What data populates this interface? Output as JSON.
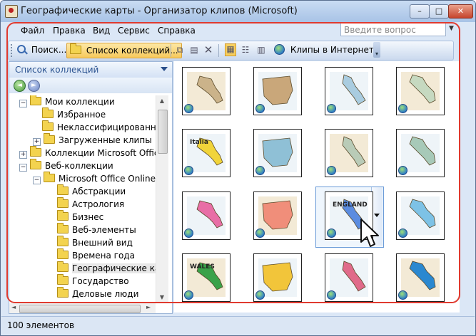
{
  "window": {
    "title": "Географические карты - Организатор клипов (Microsoft)",
    "buttons": {
      "minimize": "–",
      "maximize": "□",
      "close": "✕"
    }
  },
  "menu": {
    "items": [
      "Файл",
      "Правка",
      "Вид",
      "Сервис",
      "Справка"
    ],
    "help_placeholder": "Введите вопрос"
  },
  "toolbar": {
    "search_label": "Поиск...",
    "collections_label": "Список коллекций...",
    "online_label": "Клипы в Интернете"
  },
  "collections_pane": {
    "header": "Список коллекций",
    "tree": [
      {
        "label": "Мои коллекции",
        "expander": "−"
      },
      {
        "label": "Избранное"
      },
      {
        "label": "Неклассифицированны"
      },
      {
        "label": "Загруженные клипы",
        "expander": "+"
      },
      {
        "label": "Коллекции Microsoft Office",
        "expander": "+"
      },
      {
        "label": "Веб-коллекции",
        "expander": "−"
      },
      {
        "label": "Microsoft Office Online",
        "expander": "−"
      },
      {
        "label": "Абстракции"
      },
      {
        "label": "Астрология"
      },
      {
        "label": "Бизнес"
      },
      {
        "label": "Веб-элементы"
      },
      {
        "label": "Внешний вид"
      },
      {
        "label": "Времена года"
      },
      {
        "label": "Географические кар",
        "selected": true
      },
      {
        "label": "Государство"
      },
      {
        "label": "Деловые люди"
      }
    ]
  },
  "gallery": {
    "clips": [
      {
        "label": "",
        "color": "#cbb38a"
      },
      {
        "label": "",
        "color": "#c9a77a"
      },
      {
        "label": "",
        "color": "#a9cce0"
      },
      {
        "label": "",
        "color": "#c6d9c0"
      },
      {
        "label": "Italia",
        "color": "#f1d43a"
      },
      {
        "label": "",
        "color": "#8fc0d6"
      },
      {
        "label": "",
        "color": "#b9cbb7"
      },
      {
        "label": "",
        "color": "#a7c9b8"
      },
      {
        "label": "",
        "color": "#e86ea6"
      },
      {
        "label": "",
        "color": "#f08e7a"
      },
      {
        "label": "ENGLAND",
        "color": "#5b8ce0"
      },
      {
        "label": "",
        "color": "#7dc2e6"
      },
      {
        "label": "WALES",
        "color": "#3aa24a"
      },
      {
        "label": "",
        "color": "#f2c53a"
      },
      {
        "label": "",
        "color": "#e06a8a"
      },
      {
        "label": "",
        "color": "#2a88d0"
      }
    ]
  },
  "status": {
    "count_text": "100 элементов"
  }
}
